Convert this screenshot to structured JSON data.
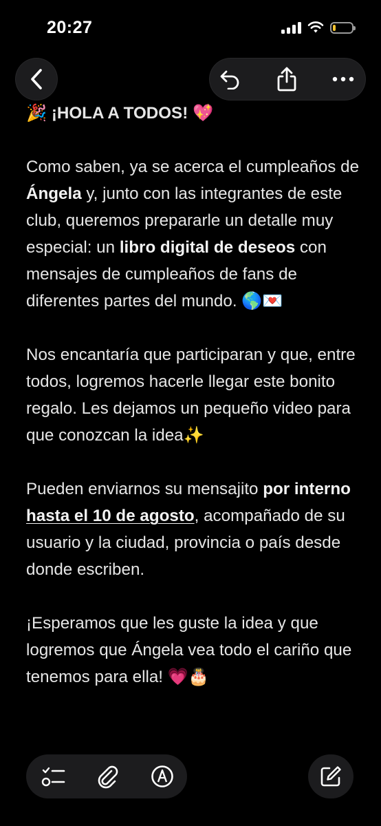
{
  "status_bar": {
    "time": "20:27",
    "battery_level": 0.15,
    "battery_color": "#f4c430",
    "icons": [
      "signal-icon",
      "wifi-icon",
      "battery-icon"
    ]
  },
  "nav": {
    "icons": [
      "back-icon",
      "undo-icon",
      "share-icon",
      "more-icon"
    ]
  },
  "note": {
    "headline": "🎉 ¡HOLA A TODOS! 💖",
    "p1": {
      "t1": "Como saben, ya se acerca el cumpleaños de ",
      "b1": "Ángela",
      "t2": " y, junto con las integrantes de este club, queremos prepararle un detalle muy especial: un ",
      "b2": "libro digital de deseos",
      "t3": " con mensajes de cumpleaños de fans de diferentes partes del mundo. 🌎💌"
    },
    "p2": "Nos encantaría que participaran y que, entre todos, logremos hacerle llegar este bonito regalo. Les dejamos un pequeño video para que conozcan la idea✨",
    "p3": {
      "t1": "Pueden enviarnos su mensajito ",
      "b1": "por interno",
      "t2": " ",
      "b2": "hasta el 10 de agosto",
      "t3": ", acompañado de su usuario y la ciudad, provincia o país desde donde escriben."
    },
    "p4": "¡Esperamos que les guste la idea y que logremos que Ángela vea todo el cariño que tenemos para ella! 💗🎂"
  },
  "toolbar": {
    "icons": [
      "checklist-icon",
      "paperclip-icon",
      "markup-pen-icon",
      "compose-icon"
    ]
  }
}
